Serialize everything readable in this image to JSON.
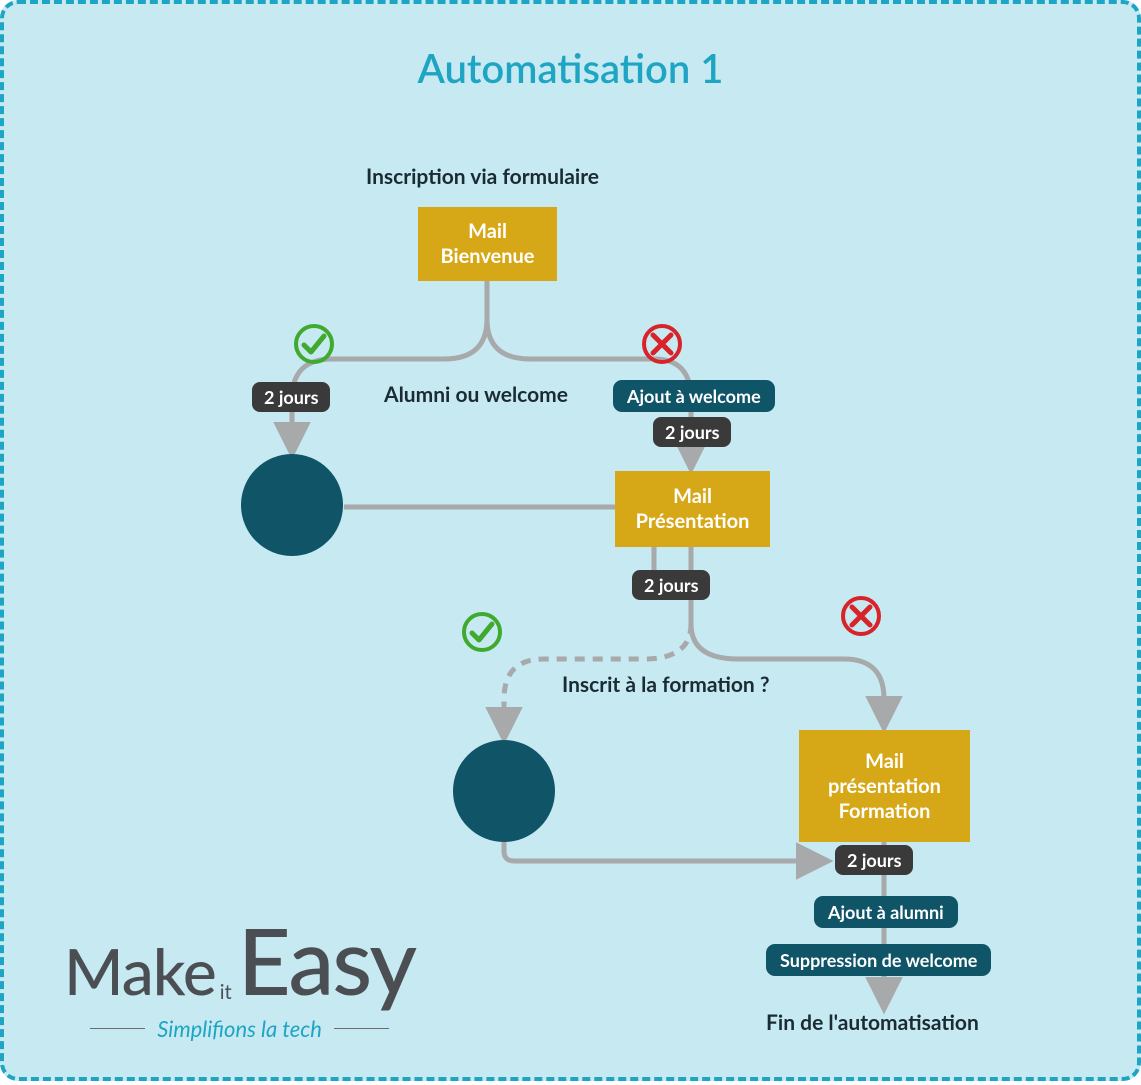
{
  "title": "Automatisation 1",
  "trigger_label": "Inscription via formulaire",
  "mail_welcome": "Mail\nBienvenue",
  "split1_question": "Alumni ou welcome",
  "left_delay": "2 jours",
  "right_action_add_welcome": "Ajout à welcome",
  "right_delay1": "2 jours",
  "mail_presentation": "Mail\nPrésentation",
  "mid_delay": "2 jours",
  "split2_question": "Inscrit à la formation ?",
  "mail_formation": "Mail\nprésentation\nFormation",
  "after_formation_delay": "2 jours",
  "action_add_alumni": "Ajout à alumni",
  "action_remove_welcome": "Suppression de welcome",
  "end_label": "Fin de l'automatisation",
  "logo": {
    "make": "Make",
    "it": "it",
    "easy": "Easy",
    "tagline": "Simplifions la tech"
  }
}
